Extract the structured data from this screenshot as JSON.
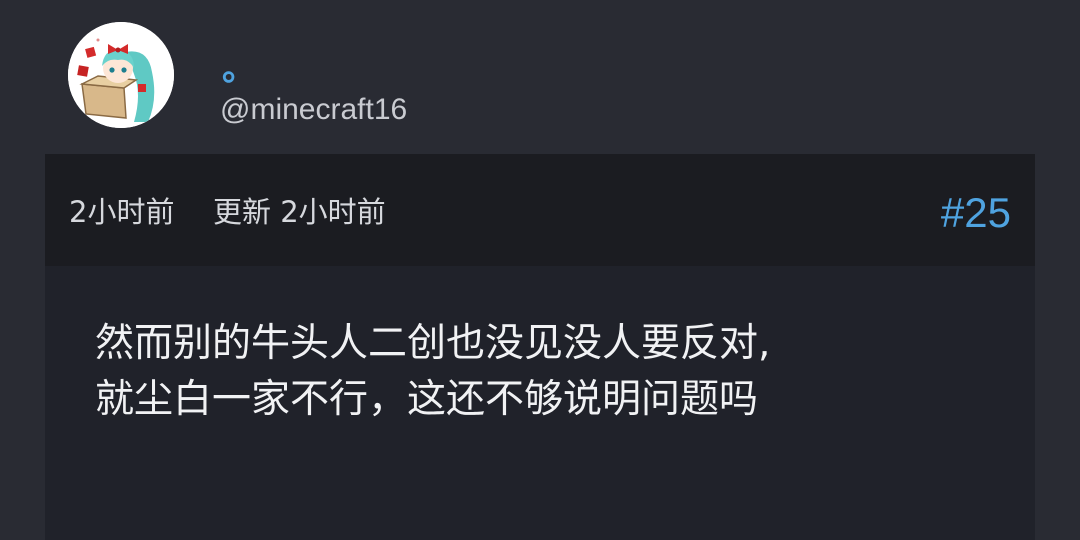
{
  "user": {
    "display_name": "。",
    "username": "@minecraft16",
    "avatar_icon": "anime-character-avatar"
  },
  "post": {
    "time_posted": "2小时前",
    "time_updated": "更新 2小时前",
    "floor": "#25",
    "lines": [
      "然而别的牛头人二创也没见没人要反对,",
      "就尘白一家不行，这还不够说明问题吗"
    ]
  },
  "colors": {
    "background": "#292b33",
    "card": "#20222a",
    "meta_bar": "#1b1c21",
    "accent": "#4fa3e0",
    "text": "#f1f2f4"
  }
}
